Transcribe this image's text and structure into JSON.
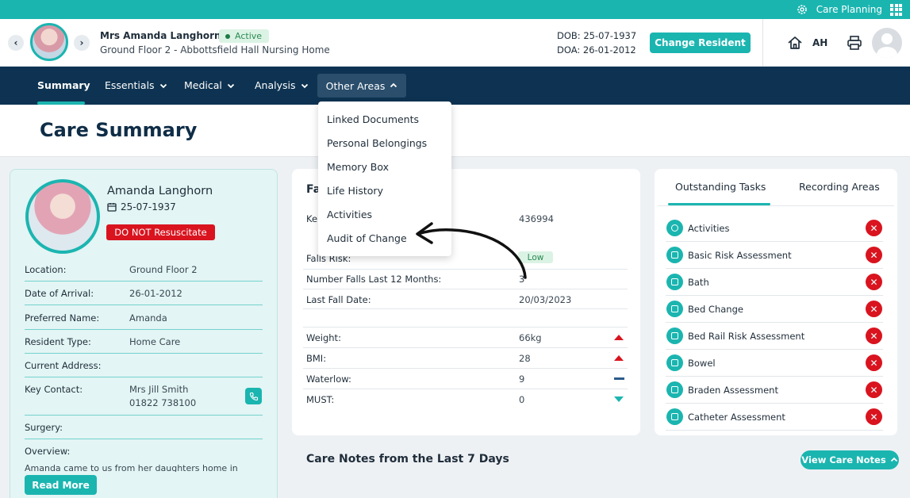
{
  "topbar": {
    "label": "Care Planning",
    "icon_left": "gear-icon",
    "icon_right": "apps-grid-icon"
  },
  "resident_header": {
    "name": "Mrs Amanda Langhorn",
    "status": "Active",
    "location": "Ground Floor 2 - Abbottsfield Hall Nursing Home",
    "dob": "DOB: 25-07-1937",
    "doa": "DOA: 26-01-2012",
    "change_button": "Change Resident",
    "user_initials": "AH"
  },
  "nav": {
    "items": [
      {
        "label": "Summary"
      },
      {
        "label": "Essentials"
      },
      {
        "label": "Medical"
      },
      {
        "label": "Analysis"
      },
      {
        "label": "Other Areas"
      }
    ]
  },
  "page_title": "Care Summary",
  "profile": {
    "name": "Amanda Langhorn",
    "dob": "25-07-1937",
    "dnr": "DO NOT Resuscitate",
    "rows": [
      {
        "label": "Location:",
        "value": "Ground Floor 2"
      },
      {
        "label": "Date of Arrival:",
        "value": "26-01-2012"
      },
      {
        "label": "Preferred Name:",
        "value": "Amanda"
      },
      {
        "label": "Resident Type:",
        "value": "Home Care"
      },
      {
        "label": "Current Address:",
        "value": ""
      },
      {
        "label": "Key Contact:",
        "value": "Mrs Jill Smith",
        "value2": "01822 738100"
      },
      {
        "label": "Surgery:",
        "value": ""
      },
      {
        "label": "Overview:",
        "value": ""
      }
    ],
    "overview_text": "Amanda came to us from her daughters home in",
    "read_more": "Read More"
  },
  "middle": {
    "title": "Fa",
    "key_label": "Ke",
    "key_value": "436994",
    "rows": [
      {
        "label": "Falls Risk:",
        "value": "Low"
      },
      {
        "label": "Number Falls Last 12 Months:",
        "value": "3"
      },
      {
        "label": "Last Fall Date:",
        "value": "20/03/2023"
      },
      {
        "label": "Weight:",
        "value": "66kg",
        "trend": "up"
      },
      {
        "label": "BMI:",
        "value": "28",
        "trend": "up"
      },
      {
        "label": "Waterlow:",
        "value": "9",
        "trend": "same"
      },
      {
        "label": "MUST:",
        "value": "0",
        "trend": "down"
      }
    ]
  },
  "tasks": {
    "tabs": [
      {
        "label": "Outstanding Tasks"
      },
      {
        "label": "Recording Areas"
      }
    ],
    "items": [
      {
        "label": "Activities"
      },
      {
        "label": "Basic Risk Assessment"
      },
      {
        "label": "Bath"
      },
      {
        "label": "Bed Change"
      },
      {
        "label": "Bed Rail Risk Assessment"
      },
      {
        "label": "Bowel"
      },
      {
        "label": "Braden Assessment"
      },
      {
        "label": "Catheter Assessment"
      }
    ]
  },
  "care_notes": {
    "title": "Care Notes from the Last 7 Days",
    "button": "View Care Notes"
  },
  "dropdown": {
    "items": [
      {
        "label": "Linked Documents"
      },
      {
        "label": "Personal Belongings"
      },
      {
        "label": "Memory Box"
      },
      {
        "label": "Life History"
      },
      {
        "label": "Activities"
      },
      {
        "label": "Audit of Change"
      }
    ]
  },
  "colors": {
    "teal": "#1bb5b0",
    "navy": "#0e3352",
    "red": "#d9141f"
  }
}
